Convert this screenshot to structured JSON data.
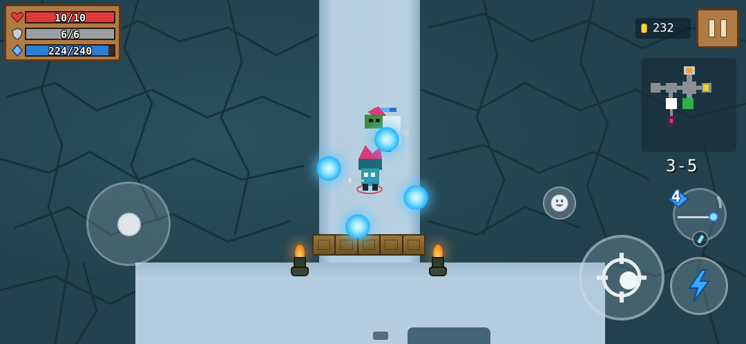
{
  "hud": {
    "health": {
      "icon": "heart-icon",
      "text": "10/10",
      "current": 10,
      "max": 10,
      "color": "#e03a3a"
    },
    "armor": {
      "icon": "shield-icon",
      "text": "6/6",
      "current": 6,
      "max": 6,
      "color": "#9aa0a3"
    },
    "energy": {
      "icon": "energy-diamond-icon",
      "text": "224/240",
      "current": 224,
      "max": 240,
      "color": "#2b7fd6"
    },
    "coins": {
      "icon": "coin-icon",
      "value": "232"
    },
    "pause": {
      "icon": "pause-icon"
    },
    "level": "3-5",
    "weapon": {
      "icon": "staff-weapon-icon",
      "energy_cost": "4"
    }
  },
  "controls": {
    "movement": "joystick",
    "emote": "smiley-icon",
    "attack": "crosshair-icon",
    "skill": "lightning-icon",
    "swap": "swap-weapon-icon"
  },
  "colors": {
    "wall": "#22404d",
    "floor": "#b5cee0",
    "panel": "#b07a44",
    "panel_border": "#5a381a",
    "orb": "#2fb7ff"
  }
}
